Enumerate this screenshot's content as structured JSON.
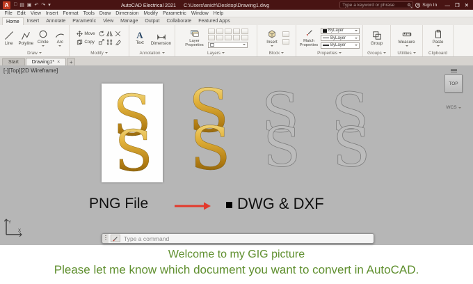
{
  "title_bar": {
    "logo_letter": "A",
    "qat_icons": [
      "□",
      "▤",
      "▣",
      "↶",
      "↷",
      "▾"
    ],
    "app_name": "AutoCAD Electrical 2021",
    "doc_path": "C:\\Users\\anich\\Desktop\\Drawing1.dwg",
    "search_placeholder": "Type a keyword or phrase",
    "sign_in": "Sign In",
    "window_controls": {
      "minimize": "—",
      "maximize": "❐",
      "close": "✕"
    }
  },
  "menu_bar": {
    "items": [
      "File",
      "Edit",
      "View",
      "Insert",
      "Format",
      "Tools",
      "Draw",
      "Dimension",
      "Modify",
      "Parametric",
      "Window",
      "Help"
    ]
  },
  "ribbon_tabs": {
    "items": [
      "Home",
      "Insert",
      "Annotate",
      "Parametric",
      "View",
      "Manage",
      "Output",
      "Collaborate",
      "Featured Apps"
    ],
    "active_tab": "Home"
  },
  "ribbon": {
    "draw": {
      "label": "Draw",
      "line": "Line",
      "polyline": "Polyline",
      "circle": "Circle",
      "arc": "Arc"
    },
    "modify": {
      "label": "Modify",
      "move": "Move",
      "copy": "Copy"
    },
    "annotation": {
      "label": "Annotation",
      "text_glyph": "A",
      "text": "Text",
      "dimension": "Dimension"
    },
    "layers": {
      "label": "Layers",
      "layer_properties": "Layer Properties"
    },
    "block": {
      "label": "Block",
      "insert": "Insert"
    },
    "properties": {
      "label": "Properties",
      "match_properties": "Match Properties",
      "bylayer_color": "ByLayer",
      "bylayer_linetype": "ByLayer",
      "bylayer_lineweight": "ByLayer"
    },
    "groups": {
      "label": "Groups",
      "group": "Group"
    },
    "utilities": {
      "label": "Utilities",
      "measure": "Measure"
    },
    "clipboard": {
      "label": "Clipboard",
      "paste": "Paste"
    }
  },
  "file_tabs": {
    "start": "Start",
    "drawing": "Drawing1*",
    "close_glyph": "×",
    "new_tab": "+"
  },
  "canvas": {
    "viewport_controls": "[-][Top][2D Wireframe]",
    "viewcube_face": "TOP",
    "wcs_label": "WCS",
    "monogram_letter": "S",
    "caption_png": "PNG File",
    "caption_dwg": "DWG & DXF",
    "ucs_x": "X",
    "ucs_y": "Y"
  },
  "command_line": {
    "placeholder": "Type a command"
  },
  "footer": {
    "line1": "Welcome to my GIG picture",
    "line2": "Please let me know which document you want to convert in AutoCAD.",
    "text_color": "#5f8f2e"
  },
  "colors": {
    "title_bar_bg": "#481413",
    "canvas_bg": "#b6b6b6",
    "gold_light": "#f8e9a0",
    "gold_dark": "#6b4a07",
    "arrow_red": "#e3392c"
  }
}
